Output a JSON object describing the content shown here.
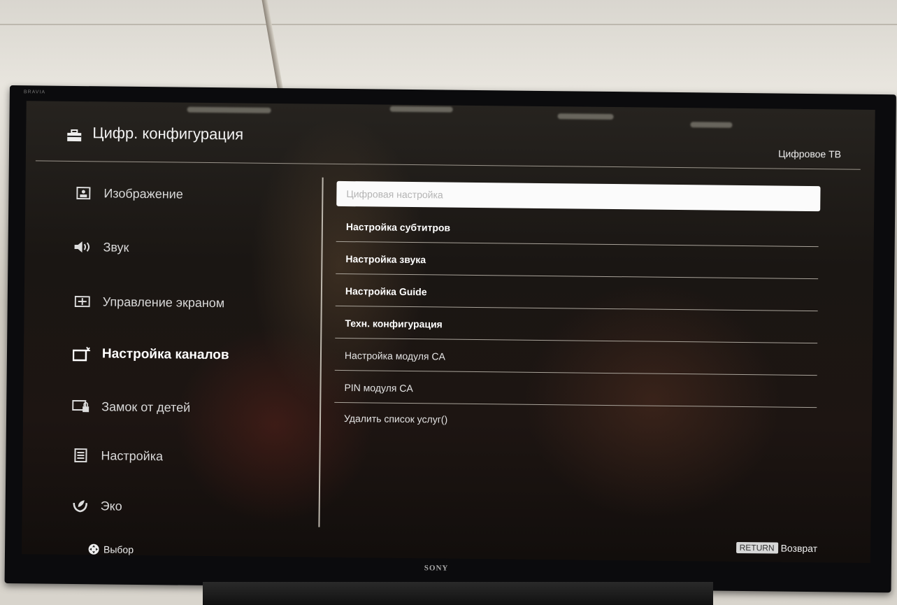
{
  "tv": {
    "brand": "BRAVIA",
    "logo": "SONY"
  },
  "header": {
    "title": "Цифр. конфигурация",
    "source": "Цифровое ТВ",
    "icon": "toolbox-icon"
  },
  "sidebar": {
    "items": [
      {
        "label": "Изображение",
        "icon": "picture-icon"
      },
      {
        "label": "Звук",
        "icon": "speaker-icon"
      },
      {
        "label": "Управление экраном",
        "icon": "screen-control-icon"
      },
      {
        "label": "Настройка каналов",
        "icon": "channel-setup-icon",
        "active": true
      },
      {
        "label": "Замок от детей",
        "icon": "parental-lock-icon"
      },
      {
        "label": "Настройка",
        "icon": "settings-icon"
      },
      {
        "label": "Эко",
        "icon": "eco-icon"
      }
    ]
  },
  "menu": {
    "items": [
      {
        "label": "Цифровая настройка",
        "selected": true
      },
      {
        "label": "Настройка субтитров"
      },
      {
        "label": "Настройка звука"
      },
      {
        "label": "Настройка Guide"
      },
      {
        "label": "Техн. конфигурация"
      },
      {
        "label": "Настройка модуля CA"
      },
      {
        "label": "PIN модуля CA"
      },
      {
        "label": "Удалить список услуг()"
      }
    ]
  },
  "footer": {
    "select_label": "Выбор",
    "return_key": "RETURN",
    "return_label": "Возврат"
  },
  "colors": {
    "selected_bg": "#fbfbfb",
    "text": "#ffffff",
    "divider": "#a9a39a"
  }
}
